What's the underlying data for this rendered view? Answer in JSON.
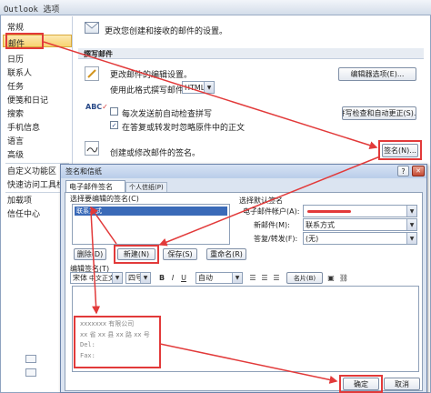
{
  "outer": {
    "title": "Outlook 选项",
    "sidebar": [
      "常规",
      "邮件",
      "日历",
      "联系人",
      "任务",
      "便笺和日记",
      "搜索",
      "手机信息",
      "语言",
      "高级",
      "自定义功能区",
      "快速访问工具栏",
      "加载项",
      "信任中心"
    ],
    "intro": "更改您创建和接收的邮件的设置。",
    "compose_section": "撰写邮件",
    "compose_desc": "更改邮件的编辑设置。",
    "format_label": "使用此格式撰写邮件:",
    "format_value": "HTML",
    "editor_options_button": "编辑器选项(E)...",
    "spell_check_label": "每次发送前自动检查拼写",
    "ignore_label": "在答复或转发时忽略原件中的正文",
    "spell_button": "拼写检查和自动更正(S)...",
    "sig_desc": "创建或修改邮件的签名。",
    "sig_button": "签名(N)..."
  },
  "dialog": {
    "title": "签名和信纸",
    "help": "?",
    "close": "✕",
    "tabs": [
      "电子邮件签名(E)",
      "个人信纸(P)"
    ],
    "select_label": "选择要编辑的签名(C)",
    "signatures": [
      "联系方式"
    ],
    "delete_button": "删除(D)",
    "new_button": "新建(N)",
    "save_button": "保存(S)",
    "rename_button": "重命名(R)",
    "default_label": "选择默认签名",
    "account_label": "电子邮件帐户(A):",
    "new_msg_label": "新邮件(M):",
    "new_msg_value": "联系方式",
    "reply_label": "答复/转发(F):",
    "reply_value": "(无)",
    "edit_label": "编辑签名(T)",
    "font_value": "宋体",
    "font_hint": "中文正文",
    "size_value": "四号",
    "auto_color": "自动",
    "business_card": "名片(B)",
    "sig_lines": [
      "xxxxxxx 有限公司",
      "xx 省 xx 县 xx 路 xx 号",
      "Del:",
      "Fax:"
    ],
    "ok_button": "确定",
    "cancel_button": "取消"
  }
}
